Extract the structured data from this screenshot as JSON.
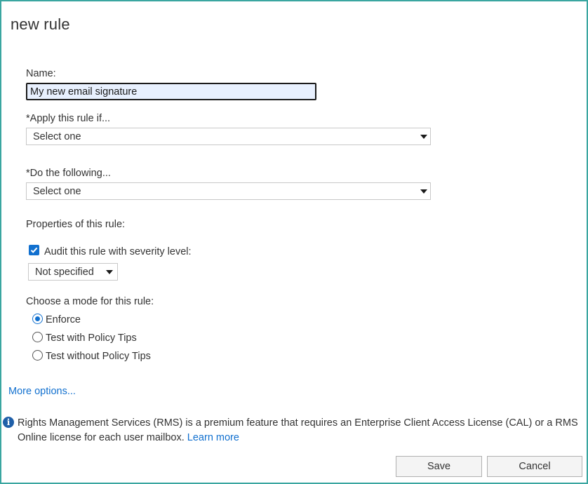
{
  "dialog": {
    "title": "new rule"
  },
  "form": {
    "name_label": "Name:",
    "name_value": "My new email signature",
    "apply_label": "*Apply this rule if...",
    "apply_selected": "Select one",
    "do_label": "*Do the following...",
    "do_selected": "Select one",
    "properties_label": "Properties of this rule:",
    "audit_label": "Audit this rule with severity level:",
    "audit_checked": true,
    "severity_selected": "Not specified",
    "mode_label": "Choose a mode for this rule:",
    "modes": [
      {
        "label": "Enforce",
        "checked": true
      },
      {
        "label": "Test with Policy Tips",
        "checked": false
      },
      {
        "label": "Test without Policy Tips",
        "checked": false
      }
    ],
    "more_options": "More options..."
  },
  "info": {
    "icon": "info-icon",
    "text": "Rights Management Services (RMS) is a premium feature that requires an Enterprise Client Access License (CAL) or a RMS Online license for each user mailbox.",
    "link": "Learn more"
  },
  "buttons": {
    "save": "Save",
    "cancel": "Cancel"
  },
  "colors": {
    "accent": "#1170cf",
    "frame_border": "#3aa6a0",
    "input_fill": "#e8f0fe"
  }
}
